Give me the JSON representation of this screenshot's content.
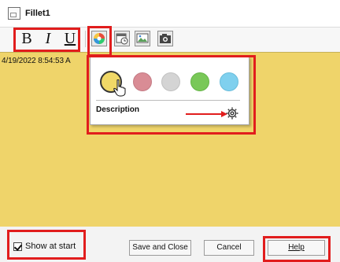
{
  "window": {
    "title": "Fillet1"
  },
  "toolbar": {
    "bold": "B",
    "italic": "I",
    "underline": "U",
    "icons": [
      "color-wheel-icon",
      "date-time-icon",
      "insert-image-icon",
      "camera-icon"
    ]
  },
  "note": {
    "timestamp": "4/19/2022 8:54:53 A"
  },
  "color_popup": {
    "swatches": [
      {
        "name": "yellow",
        "color": "#f0d867",
        "selected": true
      },
      {
        "name": "red",
        "color": "#d98c95",
        "selected": false
      },
      {
        "name": "gray",
        "color": "#d4d4d4",
        "selected": false
      },
      {
        "name": "green",
        "color": "#79c858",
        "selected": false
      },
      {
        "name": "blue",
        "color": "#7fd0ee",
        "selected": false
      }
    ],
    "description_label": "Description"
  },
  "footer": {
    "show_at_start": "Show at start",
    "show_at_start_checked": true,
    "save_close": "Save and Close",
    "cancel": "Cancel",
    "help": "Help"
  },
  "highlight_color": "#e11d1d",
  "note_color": "#efd46a"
}
